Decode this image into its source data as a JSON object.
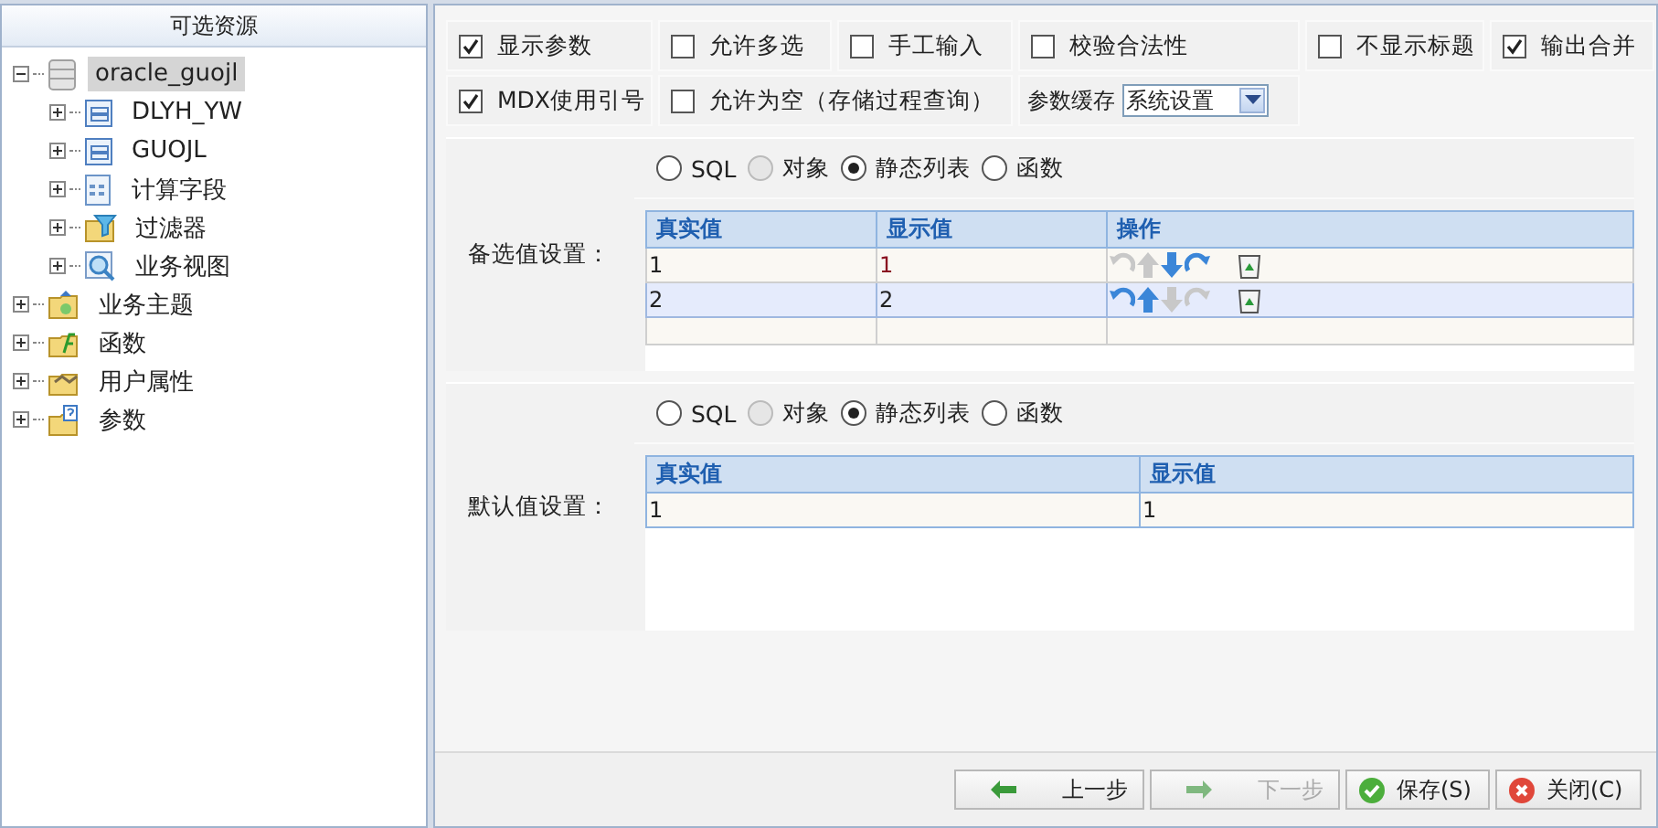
{
  "tree": {
    "title": "可选资源",
    "items": [
      {
        "label": "oracle_guojl",
        "kind": "database",
        "selected": true,
        "expanded": true,
        "children": [
          {
            "label": "DLYH_YW",
            "kind": "table",
            "selected": false,
            "expanded": false
          },
          {
            "label": "GUOJL",
            "kind": "table",
            "selected": false,
            "expanded": false
          },
          {
            "label": "计算字段",
            "kind": "calc",
            "selected": false,
            "expanded": false
          },
          {
            "label": "过滤器",
            "kind": "filter",
            "selected": false,
            "expanded": false
          },
          {
            "label": "业务视图",
            "kind": "view",
            "selected": false,
            "expanded": false
          }
        ]
      },
      {
        "label": "业务主题",
        "kind": "subject",
        "selected": false,
        "expanded": false
      },
      {
        "label": "函数",
        "kind": "function",
        "selected": false,
        "expanded": false
      },
      {
        "label": "用户属性",
        "kind": "user",
        "selected": false,
        "expanded": false
      },
      {
        "label": "参数",
        "kind": "param",
        "selected": false,
        "expanded": false
      }
    ]
  },
  "option_rows": [
    [
      {
        "label": "显示参数",
        "checked": true
      },
      {
        "label": "允许多选",
        "checked": false
      },
      {
        "label": "手工输入",
        "checked": false
      },
      {
        "label": "校验合法性",
        "checked": false
      },
      {
        "label": "不显示标题",
        "checked": false
      },
      {
        "label": "输出合并",
        "checked": true
      }
    ],
    [
      {
        "label": "MDX使用引号",
        "checked": true
      },
      {
        "label": "允许为空（存储过程查询）",
        "checked": false
      }
    ]
  ],
  "cache": {
    "label": "参数缓存",
    "value": "系统设置"
  },
  "sections": [
    {
      "label": "备选值设置：",
      "sources": [
        {
          "label": "SQL",
          "selected": false,
          "disabled": false
        },
        {
          "label": "对象",
          "selected": false,
          "disabled": true
        },
        {
          "label": "静态列表",
          "selected": true,
          "disabled": false
        },
        {
          "label": "函数",
          "selected": false,
          "disabled": false
        }
      ],
      "table": {
        "columns": [
          "真实值",
          "显示值",
          "操作"
        ],
        "rows": [
          {
            "cells": [
              "1",
              "1"
            ],
            "selected": false,
            "actions": [
              {
                "kind": "rotate-left",
                "disabled": true
              },
              {
                "kind": "up",
                "disabled": true
              },
              {
                "kind": "down",
                "disabled": false
              },
              {
                "kind": "rotate-right",
                "disabled": false
              },
              {
                "kind": "delete",
                "disabled": false
              }
            ]
          },
          {
            "cells": [
              "2",
              "2"
            ],
            "selected": true,
            "actions": [
              {
                "kind": "rotate-left",
                "disabled": false
              },
              {
                "kind": "up",
                "disabled": false
              },
              {
                "kind": "down",
                "disabled": true
              },
              {
                "kind": "rotate-right",
                "disabled": true
              },
              {
                "kind": "delete",
                "disabled": false
              }
            ]
          }
        ]
      }
    },
    {
      "label": "默认值设置：",
      "sources": [
        {
          "label": "SQL",
          "selected": false,
          "disabled": false
        },
        {
          "label": "对象",
          "selected": false,
          "disabled": true
        },
        {
          "label": "静态列表",
          "selected": true,
          "disabled": false
        },
        {
          "label": "函数",
          "selected": false,
          "disabled": false
        }
      ],
      "table": {
        "columns": [
          "真实值",
          "显示值"
        ],
        "rows": [
          {
            "cells": [
              "1",
              "1"
            ],
            "selected": false
          }
        ]
      }
    }
  ],
  "buttons": [
    {
      "label": "上一步",
      "kind": "back",
      "disabled": false
    },
    {
      "label": "下一步",
      "kind": "next",
      "disabled": true
    },
    {
      "label": "保存(S)",
      "kind": "save",
      "disabled": false
    },
    {
      "label": "关闭(C)",
      "kind": "close",
      "disabled": false
    }
  ]
}
